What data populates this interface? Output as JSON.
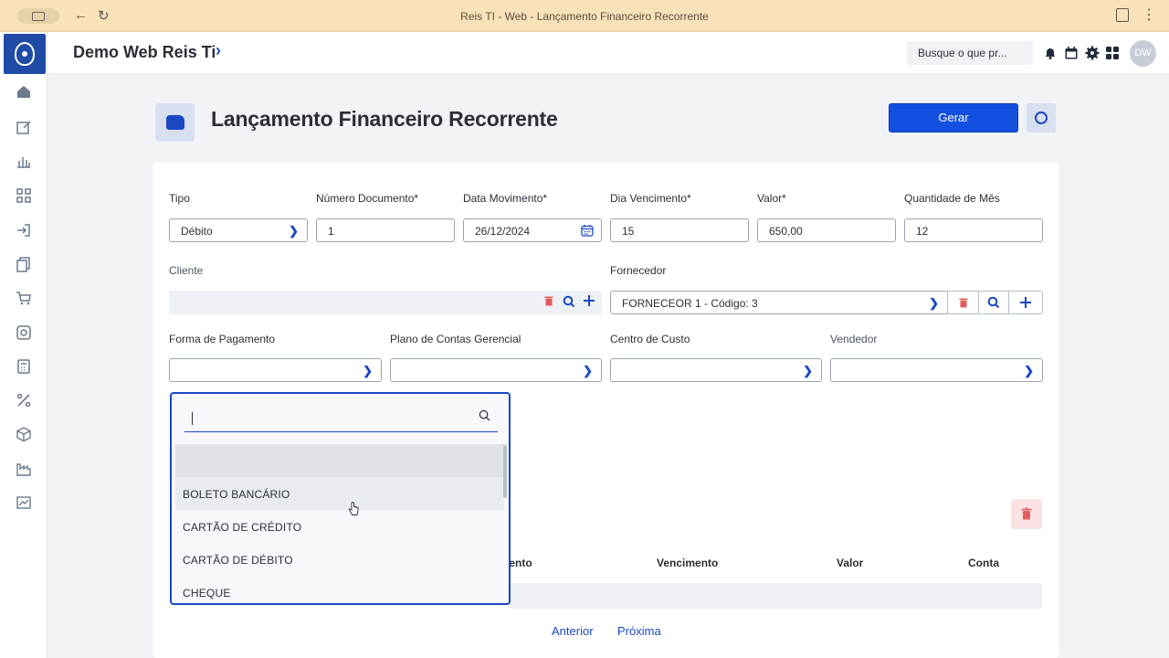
{
  "browser": {
    "tab_title": "Reis TI - Web - Lançamento Financeiro Recorrente",
    "back_glyph": "←",
    "reload_glyph": "↻",
    "menu_glyph": "⋮"
  },
  "sidebar": {
    "items": [
      "home-icon",
      "edit-icon",
      "chart-icon",
      "scan-icon",
      "login-icon",
      "copy-icon",
      "cart-icon",
      "target-icon",
      "calculator-icon",
      "percent-icon",
      "box-icon",
      "factory-icon",
      "trend-icon"
    ]
  },
  "topbar": {
    "brand": "Demo Web Reis Ti",
    "brand_chevron": "›",
    "search_placeholder": "Busque o que pr...",
    "avatar_initials": "DW"
  },
  "page": {
    "title": "Lançamento Financeiro Recorrente",
    "generate_label": "Gerar"
  },
  "form": {
    "tipo_label": "Tipo",
    "tipo_value": "Débito",
    "num_doc_label": "Número Documento*",
    "num_doc_value": "1",
    "data_mov_label": "Data Movimento*",
    "data_mov_value": "26/12/2024",
    "dia_venc_label": "Dia Vencimento*",
    "dia_venc_value": "15",
    "valor_label": "Valor*",
    "valor_value": "650,00",
    "qtd_mes_label": "Quantidade de Mês",
    "qtd_mes_value": "12",
    "cliente_label": "Cliente",
    "cliente_value": "",
    "fornecedor_label": "Fornecedor",
    "fornecedor_value": "FORNECEOR 1 - Código: 3",
    "forma_pag_label": "Forma de Pagamento",
    "plano_contas_label": "Plano de Contas Gerencial",
    "centro_custo_label": "Centro de Custo",
    "vendedor_label": "Vendedor"
  },
  "dropdown": {
    "search_value": "",
    "options": [
      "",
      "BOLETO BANCÁRIO",
      "CARTÃO DE CRÉDITO",
      "CARTÃO DE DÉBITO",
      "CHEQUE"
    ]
  },
  "table": {
    "headers": [
      "nento",
      "Vencimento",
      "Valor",
      "Conta"
    ]
  },
  "pager": {
    "previous": "Anterior",
    "next": "Próxima"
  },
  "colors": {
    "accent": "#1b47c4",
    "primary_button": "#1450e0",
    "danger": "#e35b5b",
    "chrome_bar": "#f9e2b9"
  }
}
